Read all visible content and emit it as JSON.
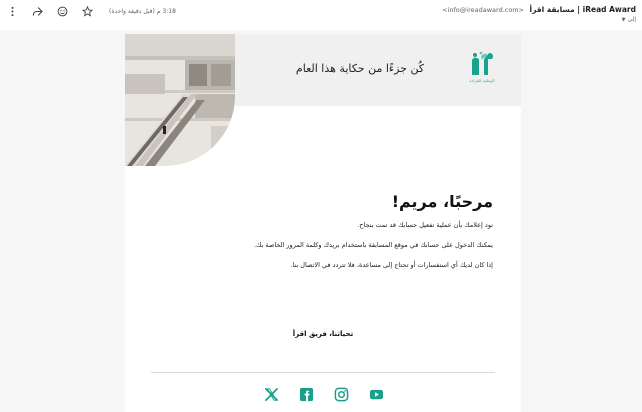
{
  "header": {
    "sender_name": "iRead Award | مسابقة اقرأ",
    "sender_email": "<info@ireadaward.com>",
    "recipient": "إلى",
    "timestamp": "3:18 م (قبل دقيقة واحدة)"
  },
  "email": {
    "tagline": "كُن جزءًا من حكاية هذا العام",
    "logo_text": "اقرأ",
    "logo_subtitle": "الوطنية للقراءة",
    "greeting": "مرحبًا، مريم!",
    "paragraphs": [
      "نود إعلامك بأن عملية تفعيل حسابك قد تمت بنجاح.",
      "يمكنك الدخول على حسابك في موقع المسابقة باستخدام بريدك وكلمة المرور الخاصة بك.",
      "إذا كان لديك أي استفسارات أو تحتاج إلى مساعدة، فلا تتردد في الاتصال بنا."
    ],
    "signoff": "تحياتنا، فريق اقرأ"
  },
  "colors": {
    "brand_teal": "#19a38c",
    "icon_teal": "#1b9e8a",
    "banner_bg": "#f0f0f0",
    "page_bg": "#f6f6f6"
  },
  "icons": {
    "toolbar": [
      "more-vert-icon",
      "forward-icon",
      "emoji-icon",
      "star-icon"
    ],
    "socials": [
      "x-icon",
      "facebook-icon",
      "instagram-icon",
      "youtube-icon"
    ]
  }
}
